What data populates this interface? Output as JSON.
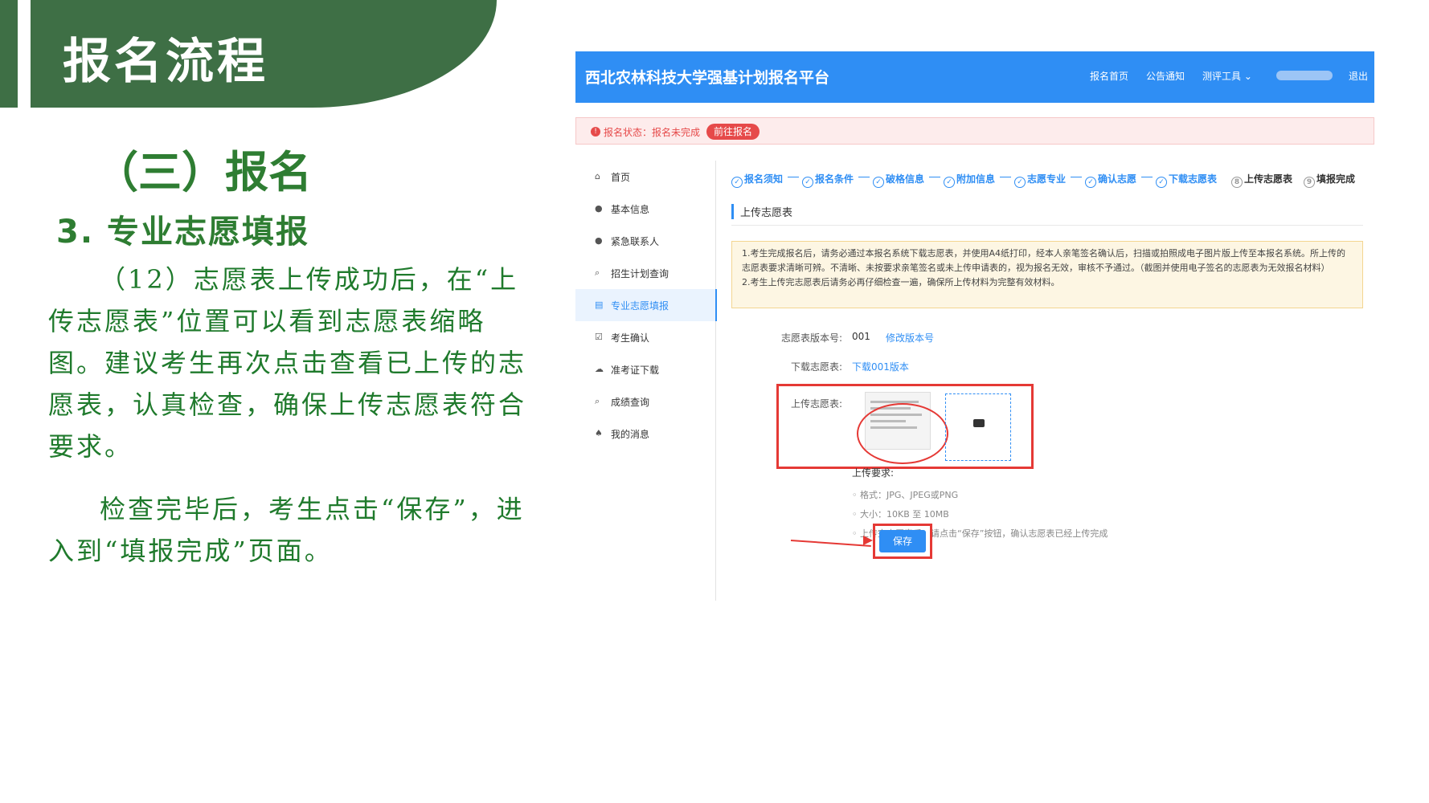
{
  "slide": {
    "title": "报名流程",
    "section_heading": "（三）报名",
    "sub_heading": "3. 专业志愿填报",
    "paragraph1": "（12）志愿表上传成功后，在“上传志愿表”位置可以看到志愿表缩略图。建议考生再次点击查看已上传的志愿表，认真检查，确保上传志愿表符合要求。",
    "paragraph2": "检查完毕后，考生点击“保存”，进入到“填报完成”页面。"
  },
  "screenshot": {
    "brand": "西北农林科技大学强基计划报名平台",
    "nav": [
      "报名首页",
      "公告通知",
      "测评工具 ⌄",
      "退出"
    ],
    "status": {
      "text": "报名状态：报名未完成",
      "button": "前往报名"
    },
    "sidebar": [
      {
        "icon": "home-icon",
        "glyph": "⌂",
        "label": "首页"
      },
      {
        "icon": "user-icon",
        "glyph": "●",
        "label": "基本信息"
      },
      {
        "icon": "user-icon",
        "glyph": "●",
        "label": "紧急联系人"
      },
      {
        "icon": "search-icon",
        "glyph": "⌕",
        "label": "招生计划查询"
      },
      {
        "icon": "document-icon",
        "glyph": "▤",
        "label": "专业志愿填报",
        "active": true
      },
      {
        "icon": "checkbox-icon",
        "glyph": "☑",
        "label": "考生确认"
      },
      {
        "icon": "cloud-download-icon",
        "glyph": "☁",
        "label": "准考证下载"
      },
      {
        "icon": "search-icon",
        "glyph": "⌕",
        "label": "成绩查询"
      },
      {
        "icon": "bell-icon",
        "glyph": "♠",
        "label": "我的消息"
      }
    ],
    "steps": [
      {
        "label": "报名须知",
        "state": "done"
      },
      {
        "label": "报名条件",
        "state": "done"
      },
      {
        "label": "破格信息",
        "state": "done"
      },
      {
        "label": "附加信息",
        "state": "done"
      },
      {
        "label": "志愿专业",
        "state": "done"
      },
      {
        "label": "确认志愿",
        "state": "done"
      },
      {
        "label": "下载志愿表",
        "state": "done"
      },
      {
        "label": "上传志愿表",
        "state": "current",
        "num": "8"
      },
      {
        "label": "填报完成",
        "state": "todo",
        "num": "9"
      }
    ],
    "section_label": "上传志愿表",
    "notice": [
      "1.考生完成报名后，请务必通过本报名系统下载志愿表，并使用A4纸打印，经本人亲笔签名确认后，扫描或拍照成电子图片版上传至本报名系统。所上传的志愿表要求清晰可辨。不清晰、未按要求亲笔签名或未上传申请表的，视为报名无效，审核不予通过。（截图并使用电子签名的志愿表为无效报名材料）",
      "2.考生上传完志愿表后请务必再仔细检查一遍，确保所上传材料为完整有效材料。"
    ],
    "form": {
      "version_label": "志愿表版本号:",
      "version_value": "001",
      "version_link": "修改版本号",
      "download_label": "下载志愿表:",
      "download_link": "下载001版本",
      "upload_label": "上传志愿表:"
    },
    "requirements": {
      "title": "上传要求:",
      "items": [
        "格式：JPG、JPEG或PNG",
        "大小：10KB 至 10MB",
        "上传完志愿表后，请点击“保存”按钮，确认志愿表已经上传完成"
      ]
    },
    "save_button": "保存"
  }
}
